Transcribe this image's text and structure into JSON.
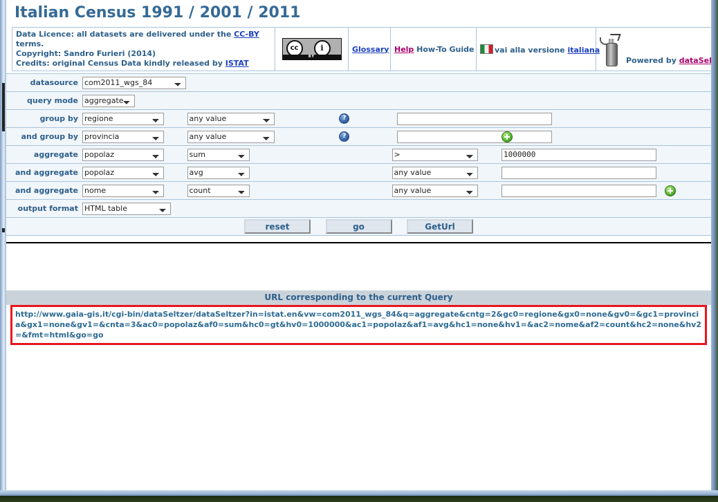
{
  "page": {
    "title": "Italian Census 1991 / 2001 / 2011"
  },
  "licence": {
    "line1_pre": "Data Licence: all datasets are delivered under the ",
    "line1_link": "CC-BY",
    "line1_post": " terms.",
    "line2": "Copyright: Sandro Furieri (2014)",
    "line3_pre": "Credits: original Census Data kindly released by ",
    "line3_link": "ISTAT",
    "cc_badge": {
      "cc": "cc",
      "info": "i",
      "by": "BY"
    },
    "glossary": "Glossary",
    "help": "Help",
    "howto": "How-To Guide",
    "italian_pre": "vai alla versione ",
    "italian_link": "italiana",
    "powered_pre": "Powered by ",
    "powered_link": "dataSeltzer"
  },
  "form": {
    "rows": [
      {
        "label": "datasource",
        "select1": "com2011_wgs_84",
        "select1_width": 150
      },
      {
        "label": "query mode",
        "select1": "aggregate",
        "select1_width": 76
      },
      {
        "label": "group by",
        "select1": "regione",
        "select2": "any value",
        "help": "?",
        "value": ""
      },
      {
        "label": "and group by",
        "select1": "provincia",
        "select2": "any value",
        "help": "?",
        "value": "",
        "plus": "+"
      },
      {
        "label": "aggregate",
        "select1": "popolaz",
        "select2": "sum",
        "select3": ">",
        "value": "1000000"
      },
      {
        "label": "and aggregate",
        "select1": "popolaz",
        "select2": "avg",
        "select3": "any value",
        "value": ""
      },
      {
        "label": "and aggregate",
        "select1": "nome",
        "select2": "count",
        "select3": "any value",
        "value": "",
        "plus": "+"
      },
      {
        "label": "output format",
        "select1": "HTML table",
        "select1_width": 128
      }
    ]
  },
  "buttons": {
    "reset": "reset",
    "go": "go",
    "geturl": "GetUrl"
  },
  "url_section": {
    "heading": "URL corresponding to the current Query",
    "url": "http://www.gaia-gis.it/cgi-bin/dataSeltzer/dataSeltzer?in=istat.en&vw=com2011_wgs_84&q=aggregate&cntg=2&gc0=regione&gx0=none&gv0=&gc1=provincia&gx1=none&gv1=&cnta=3&ac0=popolaz&af0=sum&hc0=gt&hv0=1000000&ac1=popolaz&af1=avg&hc1=none&hv1=&ac2=nome&af2=count&hc2=none&hv2=&fmt=html&go=go"
  }
}
